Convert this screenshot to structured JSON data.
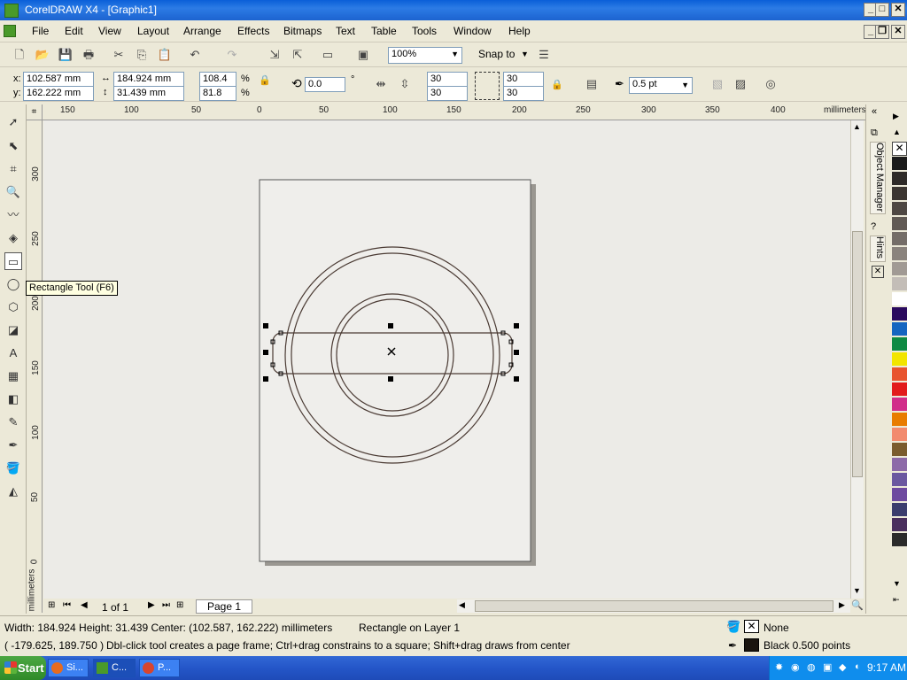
{
  "window": {
    "title": "CorelDRAW X4 - [Graphic1]",
    "min": "_",
    "max": "□",
    "close": "✕"
  },
  "menu": [
    "File",
    "Edit",
    "View",
    "Layout",
    "Arrange",
    "Effects",
    "Bitmaps",
    "Text",
    "Table",
    "Tools",
    "Window",
    "Help"
  ],
  "standard": {
    "zoom": "100%",
    "snap": "Snap to"
  },
  "props": {
    "x_label": "x:",
    "x": "102.587 mm",
    "y_label": "y:",
    "y": "162.222 mm",
    "w": "184.924 mm",
    "h": "31.439 mm",
    "sx": "108.4",
    "sy": "81.8",
    "pct": "%",
    "rot": "0.0",
    "deg": "°",
    "c1": "30",
    "c2": "30",
    "c3": "30",
    "c4": "30",
    "outline": "0.5 pt"
  },
  "hruler": {
    "ticks": [
      "150",
      "100",
      "50",
      "0",
      "50",
      "100",
      "150",
      "200",
      "250",
      "300",
      "350",
      "400"
    ],
    "unit": "millimeters"
  },
  "vruler": {
    "ticks": [
      "300",
      "250",
      "200",
      "150",
      "100",
      "50",
      "0"
    ],
    "unit": "millimeters"
  },
  "tooltip": "Rectangle Tool (F6)",
  "pages": {
    "counter": "1 of 1",
    "tab": "Page 1"
  },
  "dock": {
    "tab1": "Object Manager",
    "tab2": "Hints"
  },
  "palette": [
    "#1b1b1b",
    "#2e2a28",
    "#3c3632",
    "#4e4743",
    "#615a55",
    "#746d68",
    "#8a837d",
    "#a19a94",
    "#c3bdb7",
    "#ffffff",
    "#2a0a5e",
    "#1565c0",
    "#0e8a43",
    "#f2e500",
    "#e8542f",
    "#e21b1b",
    "#d12d8a",
    "#e87c00",
    "#f28b6e",
    "#7a5c2e",
    "#8d6aa8",
    "#6b58a0",
    "#6e4aa0",
    "#3b3d6e",
    "#4a2f5e",
    "#2b2b2b"
  ],
  "status": {
    "size": "Width: 184.924  Height: 31.439  Center: (102.587, 162.222)  millimeters",
    "object": "Rectangle on Layer 1",
    "coords": "( -179.625, 189.750 )",
    "hint": "Dbl-click tool creates a page frame; Ctrl+drag constrains to a square; Shift+drag draws from center",
    "fill": "None",
    "outline": "Black  0.500 points",
    "fill_color": "#ffffff",
    "outline_color": "#1a140e"
  },
  "taskbar": {
    "start": "Start",
    "t1": "Si...",
    "t2": "C...",
    "t3": "P...",
    "clock": "9:17 AM"
  }
}
